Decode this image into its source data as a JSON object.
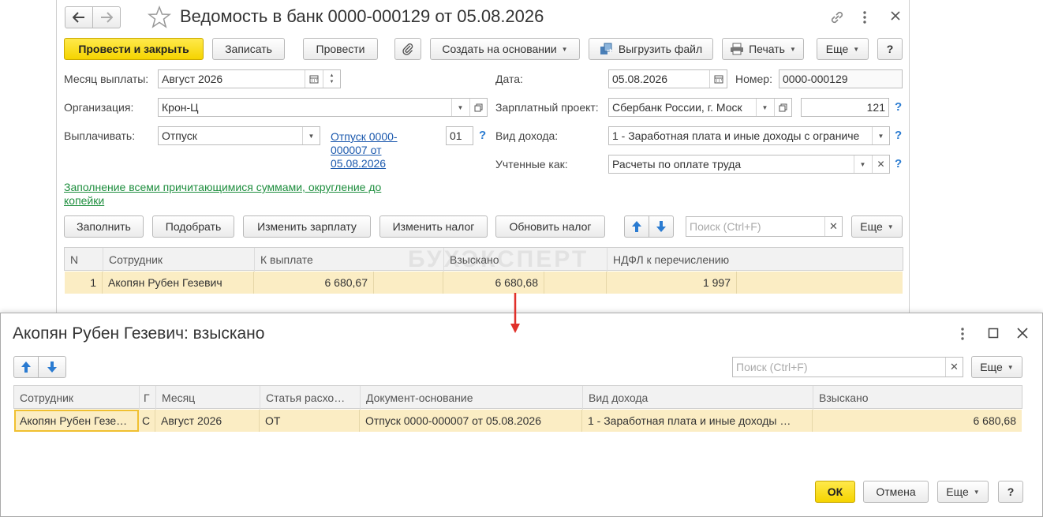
{
  "main": {
    "title": "Ведомость в банк 0000-000129 от 05.08.2026",
    "toolbar": {
      "post_close": "Провести и закрыть",
      "save": "Записать",
      "post": "Провести",
      "create_based": "Создать на основании",
      "export": "Выгрузить файл",
      "print": "Печать",
      "more": "Еще",
      "help": "?"
    },
    "form": {
      "month_label": "Месяц выплаты:",
      "month_value": "Август 2026",
      "org_label": "Организация:",
      "org_value": "Крон-Ц",
      "pay_label": "Выплачивать:",
      "pay_value": "Отпуск",
      "doc_link": "Отпуск 0000-000007 от 05.08.2026",
      "code_value": "01",
      "green_link": "Заполнение всеми причитающимися суммами, округление до копейки",
      "date_label": "Дата:",
      "date_value": "05.08.2026",
      "number_label": "Номер:",
      "number_value": "0000-000129",
      "project_label": "Зарплатный проект:",
      "project_value": "Сбербанк России, г. Моск",
      "project_count": "121",
      "income_label": "Вид дохода:",
      "income_value": "1 - Заработная плата и иные доходы с ограниче",
      "accounted_label": "Учтенные как:",
      "accounted_value": "Расчеты по оплате труда"
    },
    "table_toolbar": {
      "fill": "Заполнить",
      "pick": "Подобрать",
      "change_salary": "Изменить зарплату",
      "change_tax": "Изменить налог",
      "refresh_tax": "Обновить налог",
      "search_placeholder": "Поиск (Ctrl+F)",
      "more": "Еще"
    },
    "table": {
      "columns": [
        "N",
        "Сотрудник",
        "К выплате",
        "Взыскано",
        "НДФЛ к перечислению"
      ],
      "rows": [
        {
          "n": "1",
          "employee": "Акопян Рубен Гезевич",
          "to_pay": "6 680,67",
          "withheld": "6 680,68",
          "ndfl": "1 997"
        }
      ]
    },
    "watermark": "БУХЭКСПЕРТ"
  },
  "dialog": {
    "title": "Акопян Рубен Гезевич: взыскано",
    "search_placeholder": "Поиск (Ctrl+F)",
    "more": "Еще",
    "columns": [
      "Сотрудник",
      "Г",
      "Месяц",
      "Статья расхо…",
      "Документ-основание",
      "Вид дохода",
      "Взыскано"
    ],
    "rows": [
      {
        "employee": "Акопян Рубен Гезе…",
        "g": "С",
        "month": "Август 2026",
        "article": "ОТ",
        "doc": "Отпуск 0000-000007 от 05.08.2026",
        "income": "1 - Заработная плата и иные доходы …",
        "withheld": "6 680,68"
      }
    ],
    "ok": "ОК",
    "cancel": "Отмена",
    "help": "?"
  },
  "colors": {
    "primary_button": "#f5d400",
    "selected_row": "#fbedc4",
    "link": "#1a58ad",
    "green_link": "#1e8e3e",
    "annotation_arrow": "#e0302a"
  }
}
